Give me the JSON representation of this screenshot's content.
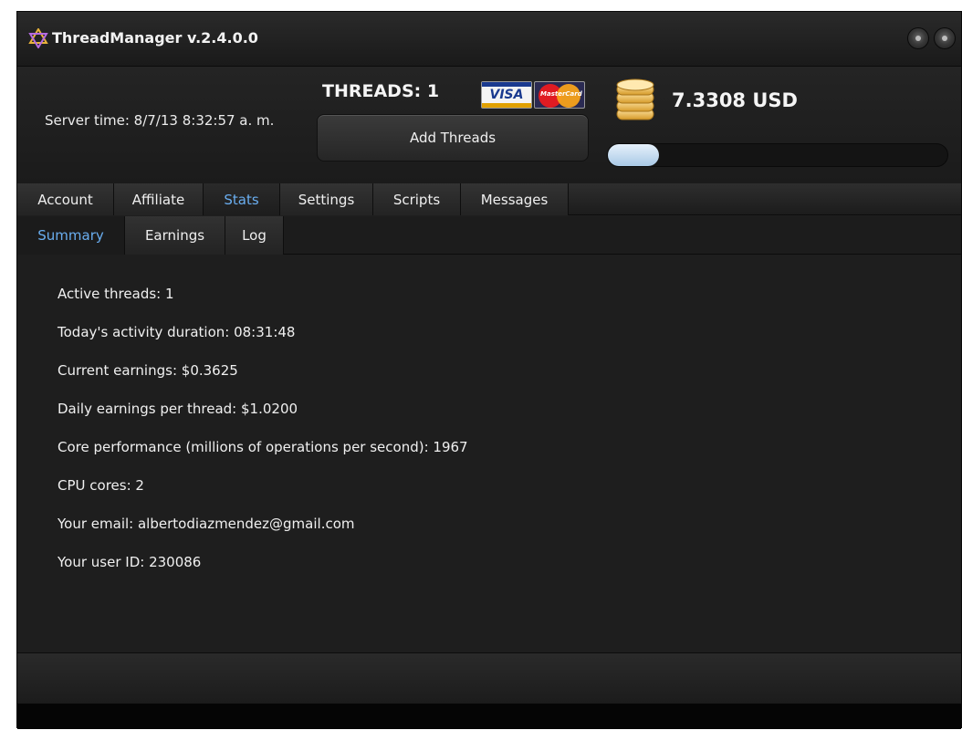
{
  "window": {
    "title": "ThreadManager v.2.4.0.0",
    "icons": {
      "app": "star-of-david-icon",
      "minimize": "minimize-icon",
      "close": "close-icon"
    }
  },
  "header": {
    "server_time": "Server time: 8/7/13 8:32:57 a. m.",
    "threads_label": "THREADS: 1",
    "add_threads_label": "Add Threads",
    "payment_cards": {
      "visa_text": "VISA",
      "mastercard_text": "MasterCard"
    },
    "balance": "7.3308 USD",
    "progress_fraction": 0.15,
    "coins_icon": "coin-stack-icon"
  },
  "tabs": [
    {
      "label": "Account"
    },
    {
      "label": "Affiliate"
    },
    {
      "label": "Stats"
    },
    {
      "label": "Settings"
    },
    {
      "label": "Scripts"
    },
    {
      "label": "Messages"
    }
  ],
  "active_tab": "Stats",
  "subtabs": [
    {
      "label": "Summary"
    },
    {
      "label": "Earnings"
    },
    {
      "label": "Log"
    }
  ],
  "active_subtab": "Summary",
  "stats": [
    "Active threads: 1",
    "Today's activity duration: 08:31:48",
    "Current earnings: $0.3625",
    "Daily earnings per thread: $1.0200",
    "Core performance (millions of operations per second): 1967",
    "CPU cores: 2",
    "Your email: albertodiazmendez@gmail.com",
    "Your user ID: 230086"
  ],
  "colors": {
    "accent": "#6aaef0",
    "background": "#1e1e1e",
    "text": "#f0f0f0"
  }
}
